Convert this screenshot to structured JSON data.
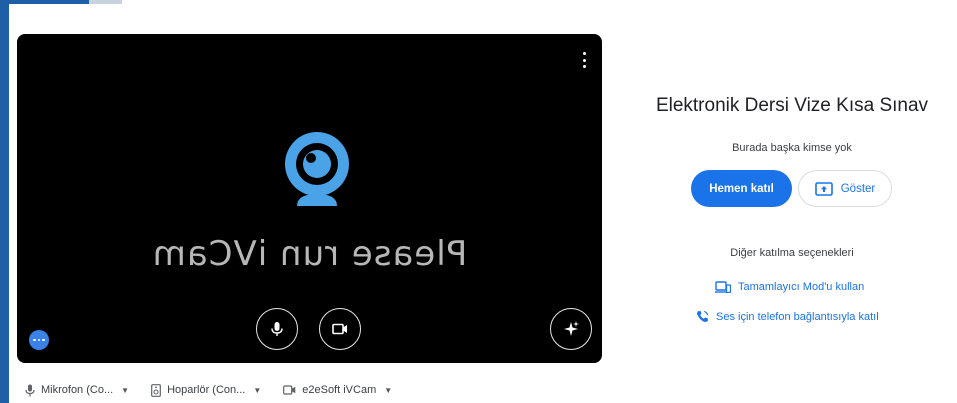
{
  "preview": {
    "camera_message": "Please run iVCam",
    "icons": {
      "more": "more-vert-icon",
      "mic": "microphone-icon",
      "camera": "video-camera-icon",
      "effects": "sparkle-effects-icon",
      "options": "more-horiz-icon"
    }
  },
  "devices": {
    "microphone_label": "Mikrofon (Co...",
    "speaker_label": "Hoparlör (Con...",
    "camera_label": "e2eSoft iVCam"
  },
  "panel": {
    "title": "Elektronik Dersi Vize Kısa Sınav",
    "status": "Burada başka kimse yok",
    "join_label": "Hemen katıl",
    "present_label": "Göster",
    "other_options_label": "Diğer katılma seçenekleri",
    "companion_label": "Tamamlayıcı Mod'u kullan",
    "phone_label": "Ses için telefon bağlantısıyla katıl"
  },
  "colors": {
    "accent": "#1a73e8",
    "ivcam_blue": "#4aa3e6",
    "frame_blue": "#1f5fa8"
  }
}
